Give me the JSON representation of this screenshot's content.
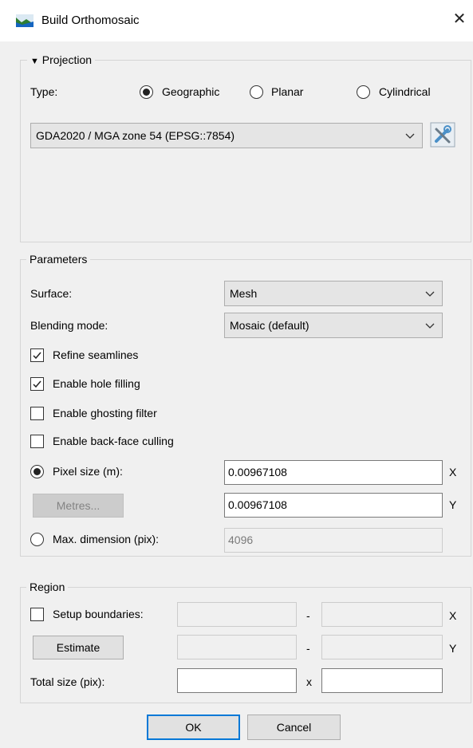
{
  "window": {
    "title": "Build Orthomosaic",
    "close_icon": "close-icon"
  },
  "projection": {
    "legend": "Projection",
    "type_label": "Type:",
    "options": [
      "Geographic",
      "Planar",
      "Cylindrical"
    ],
    "selected_type": "Geographic",
    "crs_value": "GDA2020 / MGA zone 54 (EPSG::7854)"
  },
  "parameters": {
    "legend": "Parameters",
    "surface_label": "Surface:",
    "surface_value": "Mesh",
    "blending_label": "Blending mode:",
    "blending_value": "Mosaic (default)",
    "refine_seamlines": {
      "label": "Refine seamlines",
      "checked": true
    },
    "hole_filling": {
      "label": "Enable hole filling",
      "checked": true
    },
    "ghosting_filter": {
      "label": "Enable ghosting filter",
      "checked": false
    },
    "backface_culling": {
      "label": "Enable back-face culling",
      "checked": false
    },
    "pixel_size_label": "Pixel size (m):",
    "pixel_size_x": "0.00967108",
    "pixel_size_y": "0.00967108",
    "x_label": "X",
    "y_label": "Y",
    "metres_button": "Metres...",
    "max_dimension_label": "Max. dimension (pix):",
    "max_dimension_value": "4096"
  },
  "region": {
    "legend": "Region",
    "setup_boundaries_label": "Setup boundaries:",
    "setup_boundaries_checked": false,
    "dash": "-",
    "x_label": "X",
    "y_label": "Y",
    "estimate_button": "Estimate",
    "total_size_label": "Total size (pix):",
    "times": "x"
  },
  "footer": {
    "ok_label": "OK",
    "cancel_label": "Cancel"
  },
  "colors": {
    "accent": "#0078d7",
    "background": "#f0f0f0"
  }
}
